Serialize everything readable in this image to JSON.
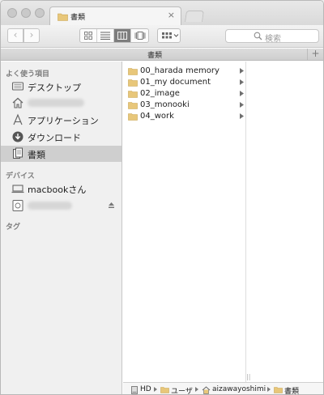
{
  "window": {
    "tab_title": "書類",
    "close_glyph": "×"
  },
  "toolbar": {
    "back_glyph": "‹",
    "forward_glyph": "›",
    "search_placeholder": "検索"
  },
  "tab_header": {
    "title": "書類",
    "add_glyph": "+"
  },
  "sidebar": {
    "favorites_header": "よく使う項目",
    "favorites": [
      {
        "label": "デスクトップ",
        "icon": "desktop-icon"
      },
      {
        "label": "",
        "icon": "home-icon"
      },
      {
        "label": "アプリケーション",
        "icon": "applications-icon"
      },
      {
        "label": "ダウンロード",
        "icon": "downloads-icon"
      },
      {
        "label": "書類",
        "icon": "documents-icon"
      }
    ],
    "devices_header": "デバイス",
    "devices": [
      {
        "label": "macbookさん",
        "icon": "laptop-icon"
      },
      {
        "label": "",
        "icon": "disk-icon"
      }
    ],
    "tags_header": "タグ"
  },
  "column": {
    "items": [
      {
        "name": "00_harada memory"
      },
      {
        "name": "01_my document"
      },
      {
        "name": "02_image"
      },
      {
        "name": "03_monooki"
      },
      {
        "name": "04_work"
      }
    ]
  },
  "pathbar": {
    "crumbs": [
      "HD",
      "ユーザ",
      "aizawayoshimi",
      "書類"
    ]
  },
  "colors": {
    "folder": "#e8c77a",
    "selected_row": "#cfcfcf",
    "section_header": "#7d7d7d"
  }
}
